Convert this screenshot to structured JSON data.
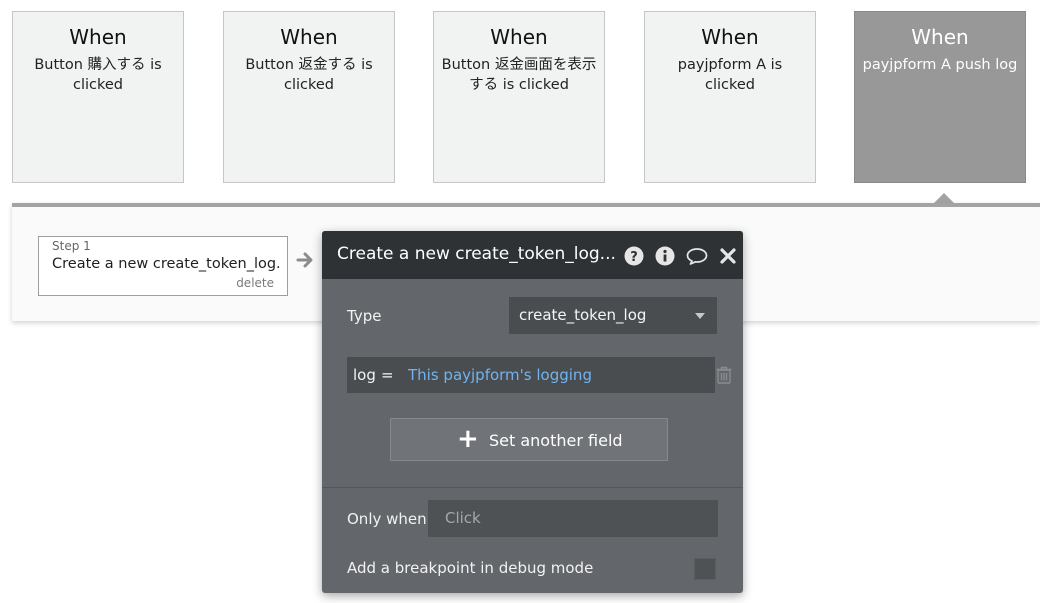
{
  "events": [
    {
      "when": "When",
      "trigger": "Button 購入する is clicked",
      "active": false
    },
    {
      "when": "When",
      "trigger": "Button 返金する is clicked",
      "active": false
    },
    {
      "when": "When",
      "trigger": "Button 返金画面を表示する is clicked",
      "active": false
    },
    {
      "when": "When",
      "trigger": "payjpform A is clicked",
      "active": false
    },
    {
      "when": "When",
      "trigger": "payjpform A push log",
      "active": true
    }
  ],
  "step": {
    "label": "Step 1",
    "title": "Create a new create_token_log...",
    "delete_label": "delete"
  },
  "panel": {
    "title": "Create a new create_token_log...",
    "icons": [
      "help-icon",
      "info-icon",
      "comment-icon",
      "close-icon"
    ],
    "type_label": "Type",
    "type_value": "create_token_log",
    "field": {
      "name": "log",
      "operator": "=",
      "expression": "This payjpform's logging"
    },
    "add_field_label": "Set another field",
    "only_when_label": "Only when",
    "only_when_placeholder": "Click",
    "breakpoint_label": "Add a breakpoint in debug mode",
    "breakpoint_checked": false
  },
  "colors": {
    "panel_bg": "#63666a",
    "panel_header": "#2f3234",
    "expression_blue": "#6fb4f0",
    "active_event": "#989898"
  }
}
